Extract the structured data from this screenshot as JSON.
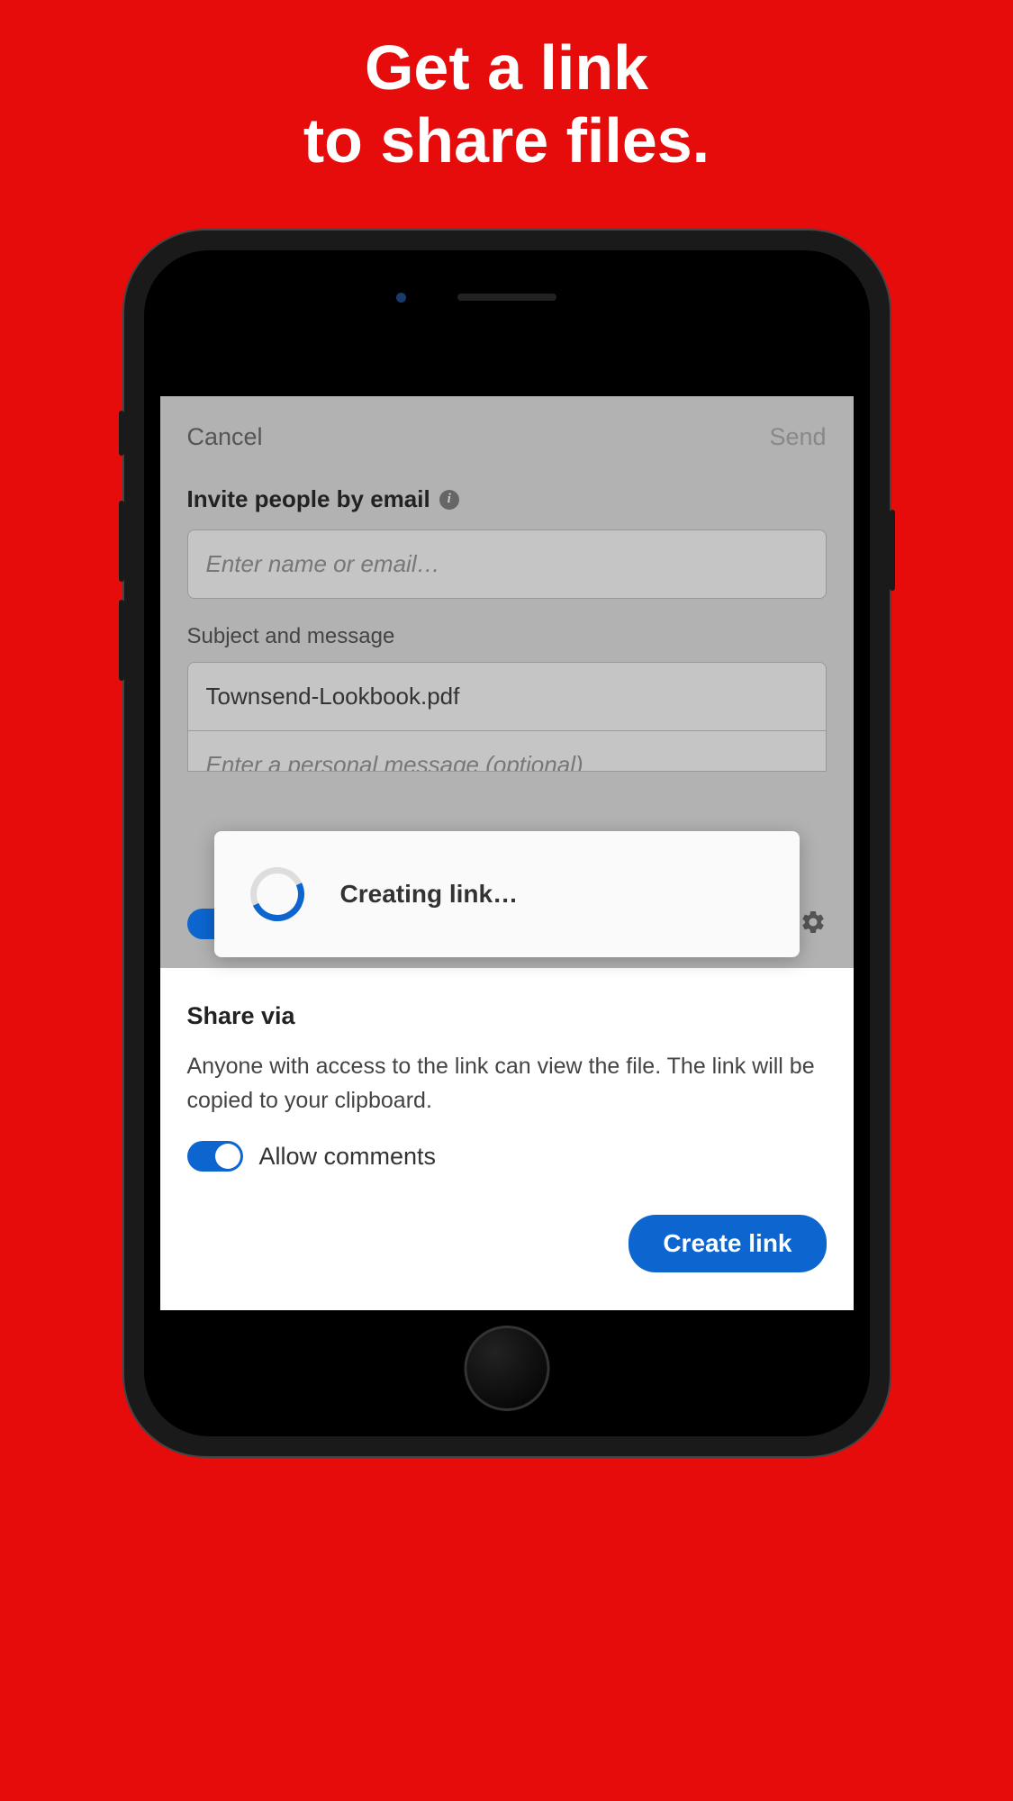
{
  "hero": {
    "line1": "Get a link",
    "line2": "to share files."
  },
  "nav": {
    "cancel": "Cancel",
    "send": "Send"
  },
  "invite": {
    "label": "Invite people by email",
    "placeholder": "Enter name or email…"
  },
  "subject": {
    "label": "Subject and message",
    "value": "Townsend-Lookbook.pdf",
    "message_placeholder": "Enter a personal message (optional)"
  },
  "allow_comments": {
    "label": "Allow comments"
  },
  "share_via": {
    "title": "Share via",
    "description": "Anyone with access to the link can view the file. The link will be copied to your clipboard.",
    "allow_comments_label": "Allow comments",
    "create_button": "Create link"
  },
  "loading": {
    "text": "Creating link…"
  }
}
